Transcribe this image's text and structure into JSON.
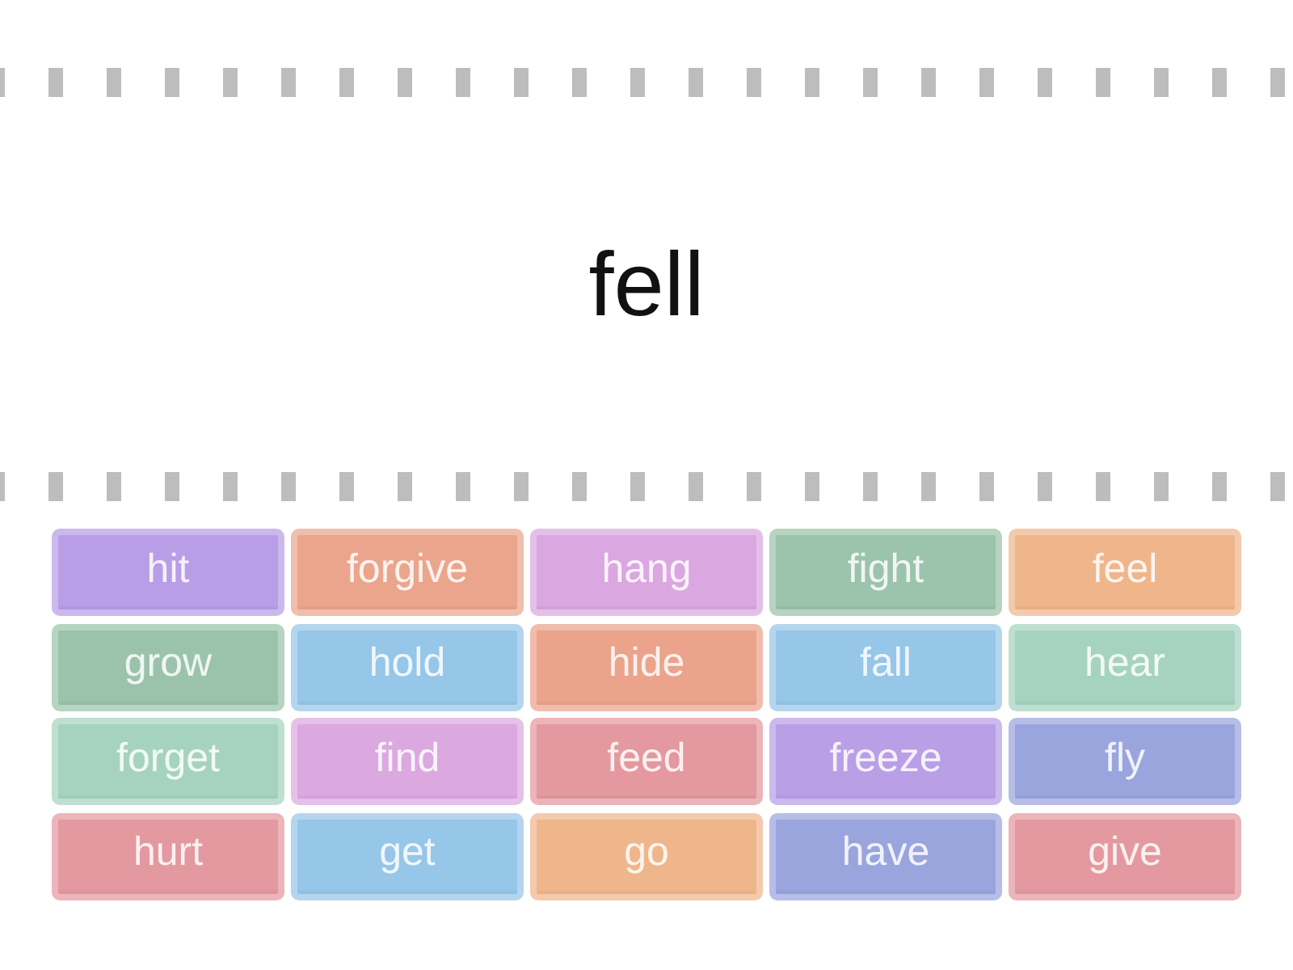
{
  "prompt": {
    "word": "fell"
  },
  "tiles": [
    {
      "label": "hit",
      "color": "#b89ee6"
    },
    {
      "label": "forgive",
      "color": "#eba58c"
    },
    {
      "label": "hang",
      "color": "#daa7e0"
    },
    {
      "label": "fight",
      "color": "#9cc3ab"
    },
    {
      "label": "feel",
      "color": "#efb68c"
    },
    {
      "label": "grow",
      "color": "#9bc3ab"
    },
    {
      "label": "hold",
      "color": "#96c6e8"
    },
    {
      "label": "hide",
      "color": "#eba38b"
    },
    {
      "label": "fall",
      "color": "#96c6e8"
    },
    {
      "label": "hear",
      "color": "#a5d3bf"
    },
    {
      "label": "forget",
      "color": "#a5d3bf"
    },
    {
      "label": "find",
      "color": "#dba8e0"
    },
    {
      "label": "feed",
      "color": "#e3999f"
    },
    {
      "label": "freeze",
      "color": "#b99fe6"
    },
    {
      "label": "fly",
      "color": "#9aa5de"
    },
    {
      "label": "hurt",
      "color": "#e3999f"
    },
    {
      "label": "get",
      "color": "#96c6e8"
    },
    {
      "label": "go",
      "color": "#efb68c"
    },
    {
      "label": "have",
      "color": "#9aa5de"
    },
    {
      "label": "give",
      "color": "#e3999f"
    }
  ]
}
